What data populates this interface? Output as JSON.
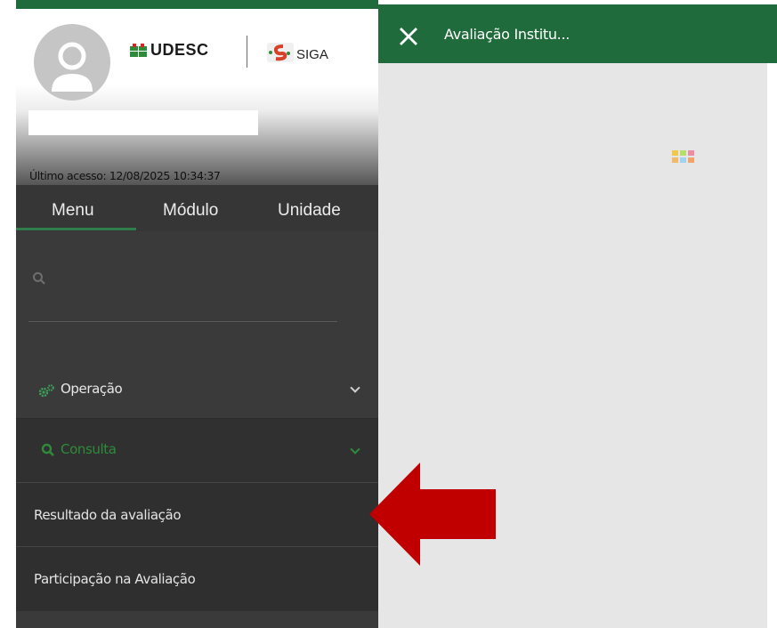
{
  "header": {
    "org_logo_text": "UDESC",
    "app_logo_text": "SIGA"
  },
  "profile": {
    "last_access": "Último acesso: 12/08/2025 10:34:37"
  },
  "tabs": [
    {
      "label": "Menu",
      "active": true
    },
    {
      "label": "Módulo",
      "active": false
    },
    {
      "label": "Unidade",
      "active": false
    }
  ],
  "search": {
    "placeholder": ""
  },
  "menu": {
    "operacao": {
      "label": "Operação",
      "icon": "gears-icon"
    },
    "consulta": {
      "label": "Consulta",
      "icon": "search-icon"
    },
    "items": [
      {
        "label": "Resultado da avaliação"
      },
      {
        "label": "Participação na Avaliação"
      }
    ]
  },
  "main": {
    "title": "Avaliação Institu..."
  },
  "colors": {
    "brand_green": "#1f6b3c",
    "menu_green": "#3aa35a",
    "arrow_red": "#c00000"
  }
}
